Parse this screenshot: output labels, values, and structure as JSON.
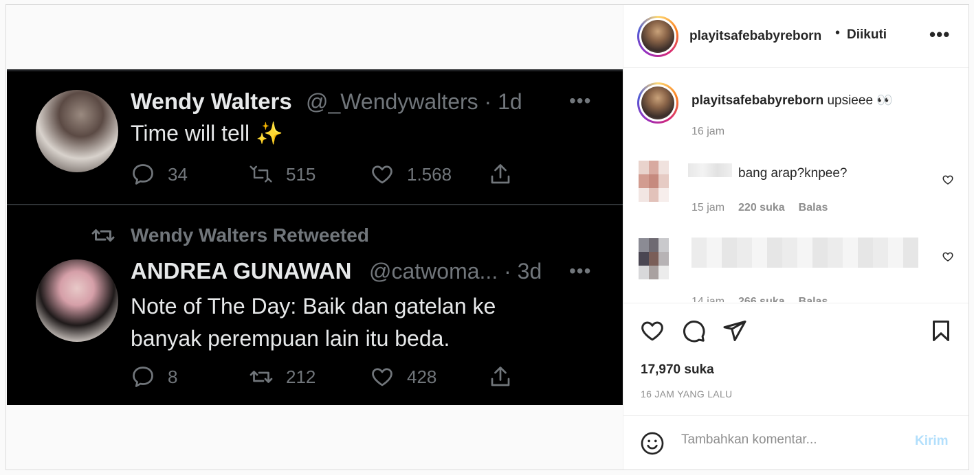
{
  "tweets": [
    {
      "name": "Wendy Walters",
      "handle": "@_Wendywalters · 1d",
      "text_lines": [
        "Time will tell ✨"
      ],
      "replies": "34",
      "retweets": "515",
      "likes": "1.568"
    },
    {
      "retweet_label": "Wendy Walters Retweeted",
      "name": "ANDREA GUNAWAN",
      "handle": "@catwoma... · 3d",
      "text_lines": [
        "Note of The Day: Baik dan gatelan ke",
        "banyak perempuan lain itu beda."
      ],
      "replies": "8",
      "retweets": "212",
      "likes": "428"
    }
  ],
  "header": {
    "username": "playitsafebabyreborn",
    "separator": "•",
    "follow_status": "Diikuti",
    "more": "•••"
  },
  "caption": {
    "username": "playitsafebabyreborn",
    "text": "upsieee 👀",
    "time": "16 jam"
  },
  "comments": [
    {
      "text": "bang arap?knpee?",
      "time": "15 jam",
      "likes": "220 suka",
      "reply": "Balas"
    },
    {
      "text": "",
      "time": "14 jam",
      "likes": "266 suka",
      "reply": "Balas"
    }
  ],
  "post": {
    "likes": "17,970 suka",
    "time_ago": "16 JAM YANG LALU"
  },
  "add_comment": {
    "placeholder": "Tambahkan komentar...",
    "post_label": "Kirim"
  },
  "colors": {
    "link_disabled": "#b2dffc",
    "muted": "#8e8e8e",
    "tweet_bg": "#000000"
  }
}
